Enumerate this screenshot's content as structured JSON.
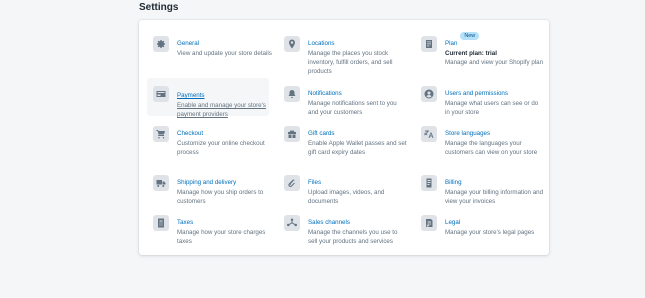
{
  "page": {
    "title": "Settings"
  },
  "settings": [
    {
      "id": "general",
      "title": "General",
      "description": "View and update your store details",
      "icon": "gear-icon"
    },
    {
      "id": "locations",
      "title": "Locations",
      "description": "Manage the places you stock inventory, fulfill orders, and sell products",
      "icon": "location-pin-icon"
    },
    {
      "id": "plan",
      "title": "Plan",
      "badge": "New",
      "subtitle": "Current plan: trial",
      "description": "Manage and view your Shopify plan",
      "icon": "document-icon"
    },
    {
      "id": "payments",
      "title": "Payments",
      "description": "Enable and manage your store's payment providers",
      "icon": "credit-card-icon",
      "active": true
    },
    {
      "id": "notifications",
      "title": "Notifications",
      "description": "Manage notifications sent to you and your customers",
      "icon": "bell-icon"
    },
    {
      "id": "users",
      "title": "Users and permissions",
      "description": "Manage what users can see or do in your store",
      "icon": "user-icon"
    },
    {
      "id": "checkout",
      "title": "Checkout",
      "description": "Customize your online checkout process",
      "icon": "cart-icon"
    },
    {
      "id": "gift-cards",
      "title": "Gift cards",
      "description": "Enable Apple Wallet passes and set gift card expiry dates",
      "icon": "gift-icon"
    },
    {
      "id": "store-languages",
      "title": "Store languages",
      "description": "Manage the languages your customers can view on your store",
      "icon": "translate-icon"
    },
    {
      "id": "shipping",
      "title": "Shipping and delivery",
      "description": "Manage how you ship orders to customers",
      "icon": "truck-icon"
    },
    {
      "id": "files",
      "title": "Files",
      "description": "Upload images, videos, and documents",
      "icon": "paperclip-icon"
    },
    {
      "id": "billing",
      "title": "Billing",
      "description": "Manage your billing information and view your invoices",
      "icon": "billing-icon"
    },
    {
      "id": "taxes",
      "title": "Taxes",
      "description": "Manage how your store charges taxes",
      "icon": "taxes-icon"
    },
    {
      "id": "sales-channels",
      "title": "Sales channels",
      "description": "Manage the channels you use to sell your products and services",
      "icon": "channels-icon"
    },
    {
      "id": "legal",
      "title": "Legal",
      "description": "Manage your store's legal pages",
      "icon": "legal-icon"
    }
  ]
}
